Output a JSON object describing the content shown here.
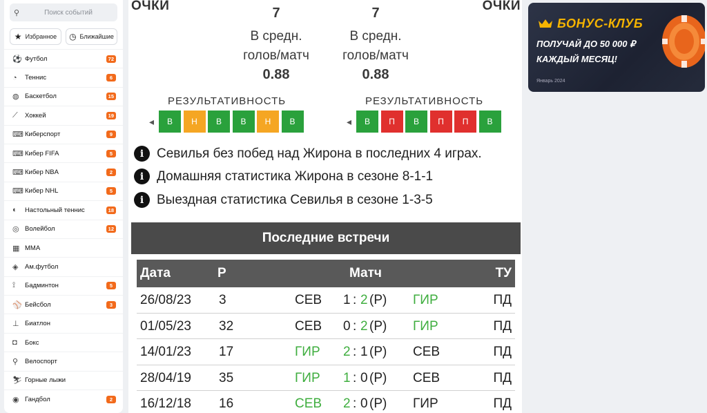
{
  "sidebar": {
    "search_placeholder": "Поиск событий",
    "favorites_label": "Избранное",
    "nearest_label": "Ближайшие",
    "sports": [
      {
        "label": "Футбол",
        "count": "72",
        "icon": "⚽"
      },
      {
        "label": "Теннис",
        "count": "6",
        "icon": "◔"
      },
      {
        "label": "Баскетбол",
        "count": "15",
        "icon": "◍"
      },
      {
        "label": "Хоккей",
        "count": "19",
        "icon": "⟋"
      },
      {
        "label": "Киберспорт",
        "count": "9",
        "icon": "⌨"
      },
      {
        "label": "Кибер FIFA",
        "count": "5",
        "icon": "⌨"
      },
      {
        "label": "Кибер NBA",
        "count": "2",
        "icon": "⌨"
      },
      {
        "label": "Кибер NHL",
        "count": "5",
        "icon": "⌨"
      },
      {
        "label": "Настольный теннис",
        "count": "18",
        "icon": "◐"
      },
      {
        "label": "Волейбол",
        "count": "12",
        "icon": "◎"
      },
      {
        "label": "MMA",
        "count": "",
        "icon": "▦"
      },
      {
        "label": "Ам.футбол",
        "count": "",
        "icon": "◈"
      },
      {
        "label": "Бадминтон",
        "count": "5",
        "icon": "⟟"
      },
      {
        "label": "Бейсбол",
        "count": "3",
        "icon": "⚾"
      },
      {
        "label": "Биатлон",
        "count": "",
        "icon": "⊥"
      },
      {
        "label": "Бокс",
        "count": "",
        "icon": "◘"
      },
      {
        "label": "Велоспорт",
        "count": "",
        "icon": "⚲"
      },
      {
        "label": "Горные лыжи",
        "count": "",
        "icon": "⛷"
      },
      {
        "label": "Гандбол",
        "count": "2",
        "icon": "◉"
      }
    ]
  },
  "stats": {
    "points_label_left": "ОЧКИ",
    "points_label_right": "ОЧКИ",
    "home_value": "7",
    "away_value": "7",
    "avg_label_line1": "В средн.",
    "avg_label_line2": "голов/матч",
    "home_avg": "0.88",
    "away_avg": "0.88",
    "form_title": "РЕЗУЛЬТАТИВНОСТЬ",
    "home_form": [
      {
        "v": "В",
        "c": "g"
      },
      {
        "v": "Н",
        "c": "o"
      },
      {
        "v": "В",
        "c": "g"
      },
      {
        "v": "В",
        "c": "g"
      },
      {
        "v": "Н",
        "c": "o"
      },
      {
        "v": "В",
        "c": "g"
      }
    ],
    "away_form": [
      {
        "v": "В",
        "c": "g"
      },
      {
        "v": "П",
        "c": "r"
      },
      {
        "v": "В",
        "c": "g"
      },
      {
        "v": "П",
        "c": "r"
      },
      {
        "v": "П",
        "c": "r"
      },
      {
        "v": "В",
        "c": "g"
      }
    ]
  },
  "facts": [
    "Севилья без побед над Жирона в последних 4 играх.",
    "Домашняя статистика Жирона в сезоне 8-1-1",
    "Выездная статистика Севилья в сезоне 1-3-5"
  ],
  "last_meetings": {
    "title": "Последние встречи",
    "headers": {
      "date": "Дата",
      "r": "Р",
      "match": "Матч",
      "tu": "ТУ"
    },
    "rows": [
      {
        "date": "26/08/23",
        "r": "3",
        "home": "СЕВ",
        "hs": "1",
        "as": "2",
        "note": "(Р)",
        "away": "ГИР",
        "winner": "away",
        "tu": "ПД"
      },
      {
        "date": "01/05/23",
        "r": "32",
        "home": "СЕВ",
        "hs": "0",
        "as": "2",
        "note": "(Р)",
        "away": "ГИР",
        "winner": "away",
        "tu": "ПД"
      },
      {
        "date": "14/01/23",
        "r": "17",
        "home": "ГИР",
        "hs": "2",
        "as": "1",
        "note": "(Р)",
        "away": "СЕВ",
        "winner": "home",
        "tu": "ПД"
      },
      {
        "date": "28/04/19",
        "r": "35",
        "home": "ГИР",
        "hs": "1",
        "as": "0",
        "note": "(Р)",
        "away": "СЕВ",
        "winner": "home",
        "tu": "ПД"
      },
      {
        "date": "16/12/18",
        "r": "16",
        "home": "СЕВ",
        "hs": "2",
        "as": "0",
        "note": "(Р)",
        "away": "ГИР",
        "winner": "home",
        "tu": "ПД"
      }
    ]
  },
  "banner": {
    "title": "БОНУС-КЛУБ",
    "line1": "ПОЛУЧАЙ ДО 50 000 ₽",
    "line2": "КАЖДЫЙ МЕСЯЦ!",
    "date": "Январь 2024",
    "accent": "#f5b400"
  }
}
